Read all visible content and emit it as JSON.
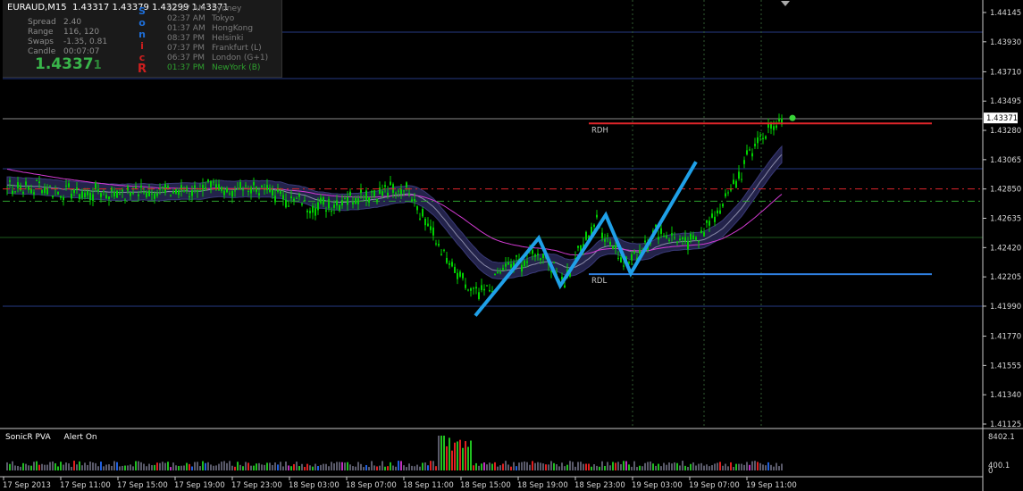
{
  "header": {
    "symbol": "EURAUD,M15",
    "ohlc": "1.43317 1.43379 1.43299 1.43371"
  },
  "info_panel": {
    "stats": [
      {
        "label": "Spread",
        "value": "2.40"
      },
      {
        "label": "Range",
        "value": "116, 120"
      },
      {
        "label": "Swaps",
        "value": "-1.35, 0.81"
      },
      {
        "label": "Candle",
        "value": "00:07:07"
      }
    ],
    "bid_main": "1.4337",
    "bid_last": "1",
    "sonic_letters": [
      "S",
      "o",
      "n",
      "i",
      "c",
      "R"
    ],
    "sessions": [
      {
        "time": "02:37 AM",
        "city": "Sydney",
        "color": "#7a7a7a"
      },
      {
        "time": "02:37 AM",
        "city": "Tokyo",
        "color": "#7a7a7a"
      },
      {
        "time": "01:37 AM",
        "city": "HongKong",
        "color": "#7a7a7a"
      },
      {
        "time": "08:37 PM",
        "city": "Helsinki",
        "color": "#7a7a7a"
      },
      {
        "time": "07:37 PM",
        "city": "Frankfurt  (L)",
        "color": "#7a7a7a"
      },
      {
        "time": "06:37 PM",
        "city": "London  (G+1)",
        "color": "#7a7a7a"
      },
      {
        "time": "01:37 PM",
        "city": "NewYork  (B)",
        "color": "#2ea02e"
      }
    ]
  },
  "chart_data": {
    "type": "candlestick",
    "symbol": "EURAUD",
    "timeframe": "M15",
    "price_axis": {
      "ticks": [
        "1.44145",
        "1.43930",
        "1.43710",
        "1.43495",
        "1.43280",
        "1.43065",
        "1.42850",
        "1.42635",
        "1.42420",
        "1.42205",
        "1.41990",
        "1.41770",
        "1.41555",
        "1.41340",
        "1.41125"
      ],
      "current_price": "1.43371",
      "range": [
        1.41125,
        1.44145
      ]
    },
    "time_axis": {
      "ticks": [
        "17 Sep 2013",
        "17 Sep 11:00",
        "17 Sep 15:00",
        "17 Sep 19:00",
        "17 Sep 23:00",
        "18 Sep 03:00",
        "18 Sep 07:00",
        "18 Sep 11:00",
        "18 Sep 15:00",
        "18 Sep 19:00",
        "18 Sep 23:00",
        "19 Sep 03:00",
        "19 Sep 07:00",
        "19 Sep 11:00"
      ]
    },
    "levels": [
      {
        "label": "RDH",
        "price": 1.43331,
        "color": "#e0262b"
      },
      {
        "label": "RDL",
        "price": 1.42225,
        "color": "#2f7fe0"
      }
    ],
    "dashed_levels": [
      {
        "price": 1.4285,
        "color": "#e0262b"
      },
      {
        "price": 1.4276,
        "color": "#2ea02e"
      }
    ],
    "zigzag": [
      {
        "time": "18 Sep 15:00",
        "price": 1.4192
      },
      {
        "time": "18 Sep 19:00",
        "price": 1.4249
      },
      {
        "time": "18 Sep 20:30",
        "price": 1.4214
      },
      {
        "time": "18 Sep 23:00",
        "price": 1.4266
      },
      {
        "time": "19 Sep 00:30",
        "price": 1.4223
      },
      {
        "time": "19 Sep 04:30",
        "price": 1.4305
      }
    ],
    "volume_panel": {
      "title": "SonicR PVA",
      "alert": "Alert On",
      "max_label": "8402.1",
      "min_label": "400.1",
      "zero_label": "0"
    },
    "colors": {
      "bull": "#00d000",
      "bear": "#00d000",
      "band": "#23234a",
      "ema": "#d23ad2",
      "zigzag": "#1fa0e8"
    }
  }
}
